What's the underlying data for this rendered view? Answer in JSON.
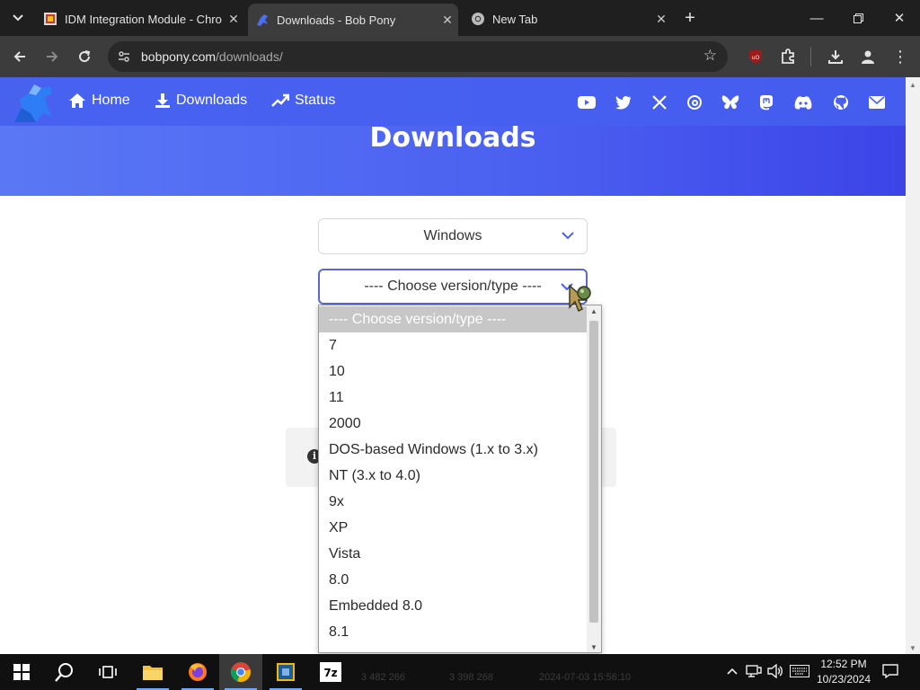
{
  "browser": {
    "tabs": [
      {
        "title": "IDM Integration Module - Chro",
        "icon": "idm-icon",
        "active": false
      },
      {
        "title": "Downloads - Bob Pony",
        "icon": "bobpony-icon",
        "active": true
      },
      {
        "title": "New Tab",
        "icon": "chrome-icon",
        "active": false
      }
    ],
    "url_domain": "bobpony.com",
    "url_path": "/downloads/"
  },
  "site": {
    "nav": [
      {
        "label": "Home",
        "icon": "home-icon"
      },
      {
        "label": "Downloads",
        "icon": "download-icon"
      },
      {
        "label": "Status",
        "icon": "trend-icon"
      }
    ],
    "social_icons": [
      "youtube-icon",
      "twitter-icon",
      "x-icon",
      "threads-icon",
      "bluesky-icon",
      "mastodon-icon",
      "discord-icon",
      "github-icon",
      "mail-icon"
    ],
    "hero_title": "Downloads",
    "accent_color": "#4a5ff0"
  },
  "form": {
    "os_select_value": "Windows",
    "version_select_value": "---- Choose version/type ----"
  },
  "dropdown": {
    "options": [
      "---- Choose version/type ----",
      "7",
      "10",
      "11",
      "2000",
      "DOS-based Windows (1.x to 3.x)",
      "NT (3.x to 4.0)",
      "9x",
      "XP",
      "Vista",
      "8.0",
      "Embedded 8.0",
      "8.1"
    ],
    "selected_index": 0
  },
  "taskbar": {
    "apps": [
      "start-icon",
      "search-icon",
      "task-view-icon",
      "file-explorer-icon",
      "firefox-icon",
      "chrome-icon",
      "virtualbox-icon",
      "7zip-icon"
    ],
    "background_text": [
      "3 482 266",
      "3 398 268",
      "2024-07-03 15:56:10"
    ],
    "time": "12:52 PM",
    "date": "10/23/2024"
  }
}
